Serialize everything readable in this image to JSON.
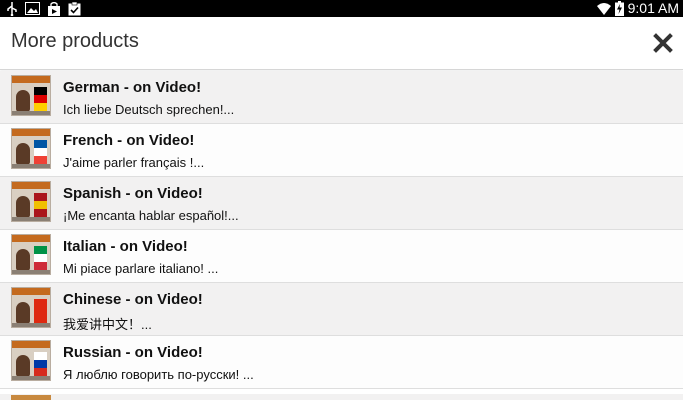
{
  "statusbar": {
    "time": "9:01 AM",
    "icons_left": [
      "usb-icon",
      "image-icon",
      "store-bag-icon",
      "clipboard-check-icon"
    ],
    "icons_right": [
      "wifi-icon",
      "battery-charging-icon"
    ]
  },
  "appbar": {
    "title": "More products",
    "close_icon": "close-icon"
  },
  "products": [
    {
      "title": "German - on Video!",
      "subtitle": "Ich liebe Deutsch sprechen!...",
      "flag_colors": [
        "#000000",
        "#dd0000",
        "#ffce00"
      ]
    },
    {
      "title": "French - on Video!",
      "subtitle": "J'aime parler français !...",
      "flag_colors": [
        "#0055a4",
        "#ffffff",
        "#ef4135"
      ]
    },
    {
      "title": "Spanish - on Video!",
      "subtitle": "¡Me encanta hablar español!...",
      "flag_colors": [
        "#aa151b",
        "#f1bf00",
        "#aa151b"
      ]
    },
    {
      "title": "Italian - on Video!",
      "subtitle": "Mi piace parlare italiano! ...",
      "flag_colors": [
        "#009246",
        "#ffffff",
        "#ce2b37"
      ]
    },
    {
      "title": "Chinese - on Video!",
      "subtitle": "我爱讲中文！...",
      "flag_colors": [
        "#de2910",
        "#de2910",
        "#de2910"
      ]
    },
    {
      "title": "Russian - on Video!",
      "subtitle": "Я люблю говорить по-русски! ...",
      "flag_colors": [
        "#ffffff",
        "#0039a6",
        "#d52b1e"
      ]
    }
  ]
}
